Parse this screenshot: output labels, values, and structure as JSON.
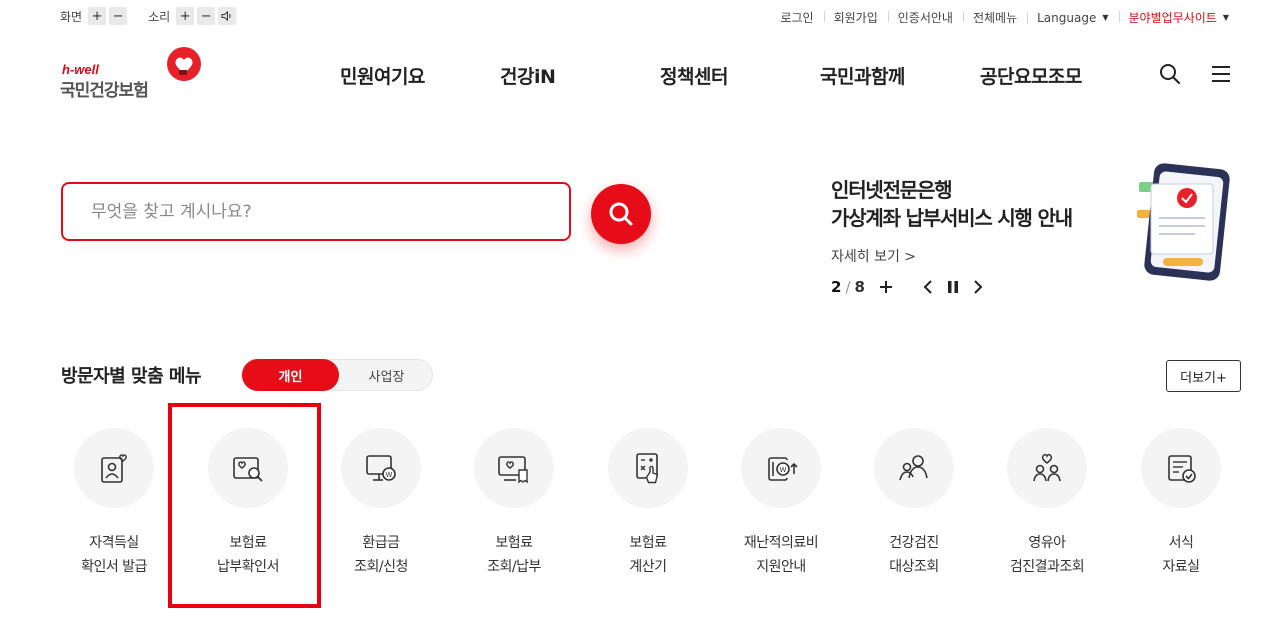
{
  "utility": {
    "screen_label": "화면",
    "sound_label": "소리",
    "plus": "+",
    "minus": "−",
    "links": [
      "로그인",
      "회원가입",
      "인증서안내",
      "전체메뉴"
    ],
    "language": "Language",
    "field_sites": "분야별업무사이트"
  },
  "logo": {
    "tagline": "h-well",
    "name": "국민건강보험"
  },
  "gnb": [
    "민원여기요",
    "건강iN",
    "정책센터",
    "국민과함께",
    "공단요모조모"
  ],
  "search": {
    "placeholder": "무엇을 찾고 계시나요?"
  },
  "banner": {
    "line1": "인터넷전문은행",
    "line2": "가상계좌 납부서비스 시행 안내",
    "more": "자세히 보기 >",
    "current": "2",
    "separator": "/",
    "total": "8"
  },
  "custom_menu": {
    "title": "방문자별 맞춤 메뉴",
    "tab_personal": "개인",
    "tab_business": "사업장",
    "more": "더보기+",
    "items": [
      {
        "l1": "자격득실",
        "l2": "확인서 발급",
        "icon": "person-heart-card-icon"
      },
      {
        "l1": "보험료",
        "l2": "납부확인서",
        "icon": "heart-document-search-icon"
      },
      {
        "l1": "환급금",
        "l2": "조회/신청",
        "icon": "monitor-won-icon"
      },
      {
        "l1": "보험료",
        "l2": "조회/납부",
        "icon": "monitor-heart-receipt-icon"
      },
      {
        "l1": "보험료",
        "l2": "계산기",
        "icon": "calculator-hand-icon"
      },
      {
        "l1": "재난적의료비",
        "l2": "지원안내",
        "icon": "won-coin-up-icon"
      },
      {
        "l1": "건강검진",
        "l2": "대상조회",
        "icon": "people-group-icon"
      },
      {
        "l1": "영유아",
        "l2": "검진결과조회",
        "icon": "parents-heart-icon"
      },
      {
        "l1": "서식",
        "l2": "자료실",
        "icon": "document-check-icon"
      }
    ]
  },
  "colors": {
    "brand_red": "#e60d19",
    "text": "#222222",
    "circle_bg": "#f4f4f4"
  }
}
